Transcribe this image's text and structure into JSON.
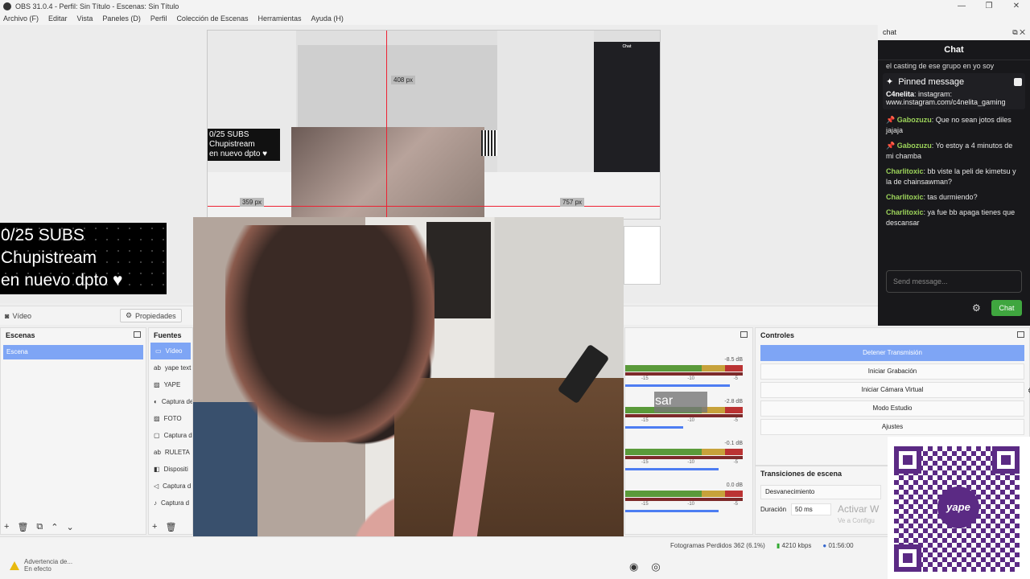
{
  "window": {
    "title": "OBS 31.0.4 - Perfil: Sin Título - Escenas: Sin Título",
    "controls": [
      "—",
      "❐",
      "✕"
    ]
  },
  "menu": [
    "Archivo (F)",
    "Editar",
    "Vista",
    "Paneles (D)",
    "Perfil",
    "Colección de Escenas",
    "Herramientas",
    "Ayuda (H)"
  ],
  "preview": {
    "overlay_lines": [
      "0/25 SUBS",
      "Chupistream",
      "en nuevo dpto ♥"
    ],
    "nested_overlay_lines": [
      "0/25 SUBS",
      "Chupistream",
      "en nuevo dpto ♥"
    ],
    "px_labels": [
      "359 px",
      "757 px",
      "408 px"
    ],
    "nested_chat_title": "Chat"
  },
  "context_bar": {
    "source": "Vídeo",
    "properties": "Propiedades"
  },
  "scenes": {
    "title": "Escenas",
    "items": [
      "Escena"
    ]
  },
  "sources": {
    "title": "Fuentes",
    "items": [
      {
        "icon": "camera-icon",
        "glyph": "▭",
        "label": "Vídeo",
        "selected": true
      },
      {
        "icon": "text-icon",
        "glyph": "ab",
        "label": "yape text"
      },
      {
        "icon": "image-icon",
        "glyph": "▨",
        "label": "YAPE"
      },
      {
        "icon": "gamepad-icon",
        "glyph": "◐",
        "label": "Captura de"
      },
      {
        "icon": "image-icon",
        "glyph": "▨",
        "label": "FOTO"
      },
      {
        "icon": "window-icon",
        "glyph": "▢",
        "label": "Captura de"
      },
      {
        "icon": "text-icon",
        "glyph": "ab",
        "label": "RULETA"
      },
      {
        "icon": "audio-icon",
        "glyph": "◧",
        "label": "Dispositi"
      },
      {
        "icon": "speaker-icon",
        "glyph": "◁",
        "label": "Captura d"
      },
      {
        "icon": "mic-icon",
        "glyph": "♪",
        "label": "Captura d"
      }
    ]
  },
  "mixer": {
    "channels": [
      {
        "db": "-8.5 dB",
        "volume_fraction": 1.0
      },
      {
        "db": "-2.8 dB",
        "volume_fraction": 0.55
      },
      {
        "db": "-0.1 dB",
        "volume_fraction": 0.89
      },
      {
        "db": "0.0 dB",
        "volume_fraction": 0.89
      }
    ],
    "ticks": [
      "-15",
      "-10",
      "-5"
    ]
  },
  "controls": {
    "title": "Controles",
    "buttons": [
      {
        "label": "Detener Transmisión",
        "active": true
      },
      {
        "label": "Iniciar Grabación"
      },
      {
        "label": "Iniciar Cámara Virtual"
      },
      {
        "label": "Modo Estudio"
      },
      {
        "label": "Ajustes"
      }
    ]
  },
  "transitions": {
    "title": "Transiciones de escena",
    "selected": "Desvanecimiento",
    "duration_label": "Duración",
    "duration_value": "50 ms"
  },
  "watermark": {
    "line1": "Activar W",
    "line2": "Ve a Configu"
  },
  "chat": {
    "dock_title": "chat",
    "title": "Chat",
    "truncated": "el casting de ese grupo en yo soy",
    "pinned_label": "Pinned message",
    "pinned": {
      "user": "C4nelita",
      "text": "instagram: www.instagram.com/c4nelita_gaming"
    },
    "messages": [
      {
        "user": "Gabozuzu",
        "color": "#9cd35a",
        "text": "Que no sean jotos diles jajaja",
        "badge": "📌"
      },
      {
        "user": "Gabozuzu",
        "color": "#9cd35a",
        "text": "Yo estoy a 4 minutos de mi chamba",
        "badge": "📌"
      },
      {
        "user": "Charlitoxic",
        "color": "#9cd35a",
        "text": "bb viste la peli de kimetsu y la de chainsawman?"
      },
      {
        "user": "Charlitoxic",
        "color": "#9cd35a",
        "text": "tas durmiendo?"
      },
      {
        "user": "Charlitoxic",
        "color": "#9cd35a",
        "text": "ya fue bb apaga tienes que descansar"
      }
    ],
    "input_placeholder": "Send message...",
    "send_label": "Chat"
  },
  "overlay_text": "sar",
  "status": {
    "warning_line1": "Advertencia de...",
    "warning_line2": "En efecto",
    "frames": "Fotogramas Perdidos 362 (6.1%)",
    "bitrate": "4210 kbps",
    "time": "01:56:00"
  },
  "qr": {
    "logo_text": "yape",
    "brand_color": "#5b2a84"
  }
}
